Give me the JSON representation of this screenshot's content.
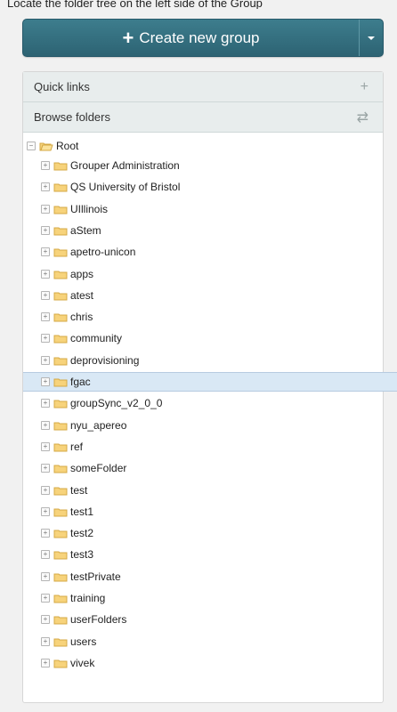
{
  "top_caption": "Locate the folder tree on the left side of the Group",
  "create_button": {
    "label": "Create new group"
  },
  "panel_quick_links": {
    "label": "Quick links",
    "icon": "plus-icon"
  },
  "panel_browse_folders": {
    "label": "Browse folders",
    "icon": "swap-icon"
  },
  "tree": {
    "root": "Root",
    "items": [
      "Grouper Administration",
      "QS University of Bristol",
      "UIllinois",
      "aStem",
      "apetro-unicon",
      "apps",
      "atest",
      "chris",
      "community",
      "deprovisioning",
      "fgac",
      "groupSync_v2_0_0",
      "nyu_apereo",
      "ref",
      "someFolder",
      "test",
      "test1",
      "test2",
      "test3",
      "testPrivate",
      "training",
      "userFolders",
      "users",
      "vivek"
    ],
    "selected": "fgac"
  },
  "colors": {
    "accent": "#2f6f80",
    "selection": "#d9e8f5"
  }
}
